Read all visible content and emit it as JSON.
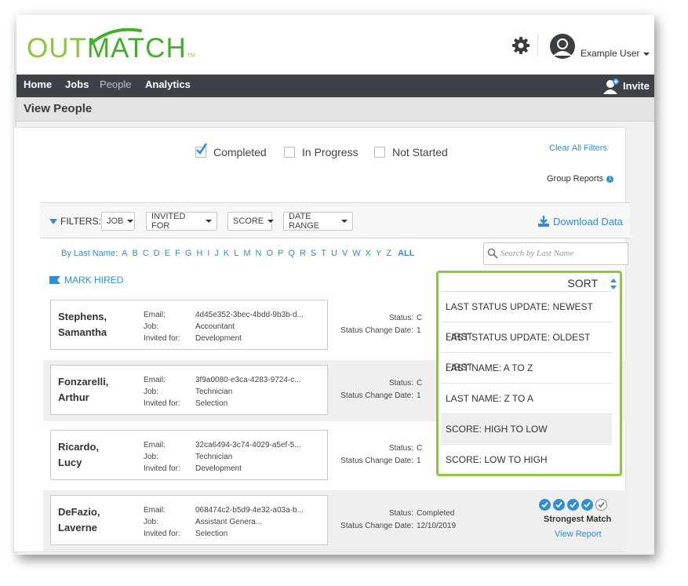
{
  "brand": {
    "logo_left": "OUT",
    "logo_right": "MATCH",
    "tm": "TM"
  },
  "header": {
    "user_name": "Example User",
    "icons": [
      "gear-icon",
      "user-avatar-icon"
    ]
  },
  "nav": {
    "items": [
      "Home",
      "Jobs",
      "People",
      "Analytics"
    ],
    "active": "People",
    "invite_label": "Invite"
  },
  "page": {
    "title": "View People"
  },
  "status_filters": [
    {
      "label": "Completed",
      "checked": true
    },
    {
      "label": "In Progress",
      "checked": false
    },
    {
      "label": "Not Started",
      "checked": false
    }
  ],
  "links": {
    "clear_filters": "Clear All Filters",
    "group_reports": "Group Reports",
    "download": "Download Data",
    "mark_hired": "MARK HIRED"
  },
  "filters": {
    "label": "FILTERS:",
    "dropdowns": [
      "JOB",
      "INVITED FOR",
      "SCORE",
      "DATE RANGE"
    ]
  },
  "alphabet": {
    "label": "By Last Name:",
    "letters": [
      "A",
      "B",
      "C",
      "D",
      "E",
      "F",
      "G",
      "H",
      "I",
      "J",
      "K",
      "L",
      "M",
      "N",
      "O",
      "P",
      "Q",
      "R",
      "S",
      "T",
      "U",
      "V",
      "W",
      "X",
      "Y",
      "Z"
    ],
    "all": "ALL"
  },
  "search": {
    "placeholder": "Search by Last Name"
  },
  "sort": {
    "label": "SORT",
    "options": [
      "LAST STATUS UPDATE: NEWEST FIRST",
      "LAST STATUS UPDATE: OLDEST FIRST",
      "LAST NAME: A TO Z",
      "LAST NAME: Z TO A",
      "SCORE: HIGH TO LOW",
      "SCORE: LOW TO HIGH"
    ],
    "highlighted": "SCORE: HIGH TO LOW"
  },
  "field_labels": {
    "email": "Email:",
    "job": "Job:",
    "invited_for": "Invited for:",
    "status": "Status:",
    "status_change": "Status Change Date:"
  },
  "people": [
    {
      "first": "Stephens,",
      "last": "Samantha",
      "email": "4d45e352-3bec-4bdd-9b3b-d...",
      "job": "Accountant",
      "invited_for": "Development",
      "status": "C",
      "date": "1"
    },
    {
      "first": "Fonzarelli,",
      "last": "Arthur",
      "email": "3f9a0080-e3ca-4283-9724-c...",
      "job": "Technician",
      "invited_for": "Selection",
      "status": "C",
      "date": "1"
    },
    {
      "first": "Ricardo,",
      "last": "Lucy",
      "email": "32ca6494-3c74-4029-a5ef-5...",
      "job": "Technician",
      "invited_for": "Development",
      "status": "C",
      "date": "1"
    },
    {
      "first": "DeFazio,",
      "last": "Laverne",
      "email": "068474c2-b5d9-4e32-a03a-b...",
      "job": "Assistant Genera...",
      "invited_for": "Selection",
      "status": "Completed",
      "date": "12/10/2019",
      "score": {
        "filled": 4,
        "total": 5,
        "label": "Strongest Match",
        "link": "View Report"
      }
    }
  ],
  "colors": {
    "green": "#8dc63f",
    "blue": "#2d8fd5",
    "nav": "#3d4148"
  }
}
